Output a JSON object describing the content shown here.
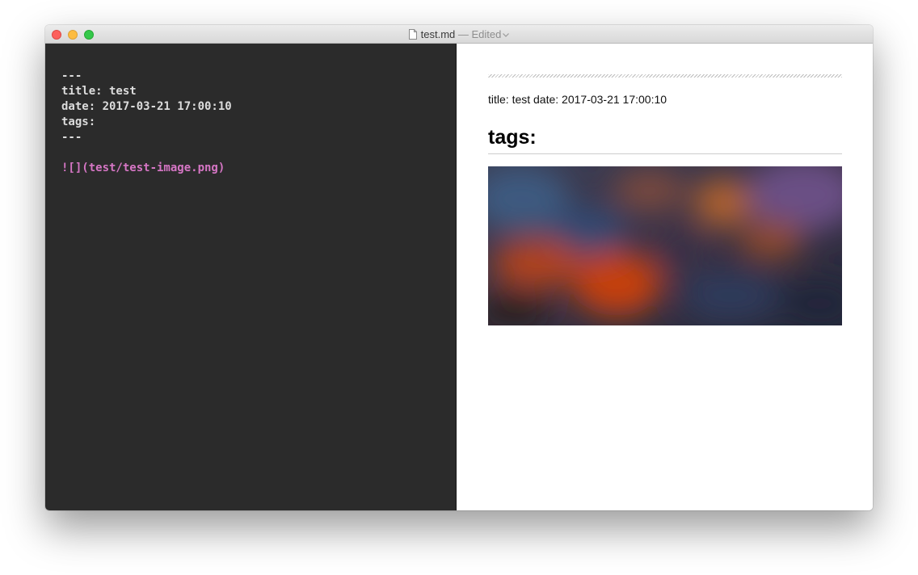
{
  "window": {
    "filename": "test.md",
    "separator": "—",
    "status": "Edited"
  },
  "editor": {
    "lines": [
      "---",
      "title: test",
      "date: 2017-03-21 17:00:10",
      "tags:",
      "---",
      "",
      "![](test/test-image.png)"
    ],
    "colors": {
      "background": "#2b2b2b",
      "text": "#dcdcdc",
      "image_syntax": "#d676c5"
    }
  },
  "preview": {
    "meta_text": "title: test date: 2017-03-21 17:00:10",
    "heading": "tags:",
    "image_description": "blurred-abstract-image"
  },
  "icons": {
    "document": "document-icon",
    "chevron": "chevron-down-icon"
  }
}
